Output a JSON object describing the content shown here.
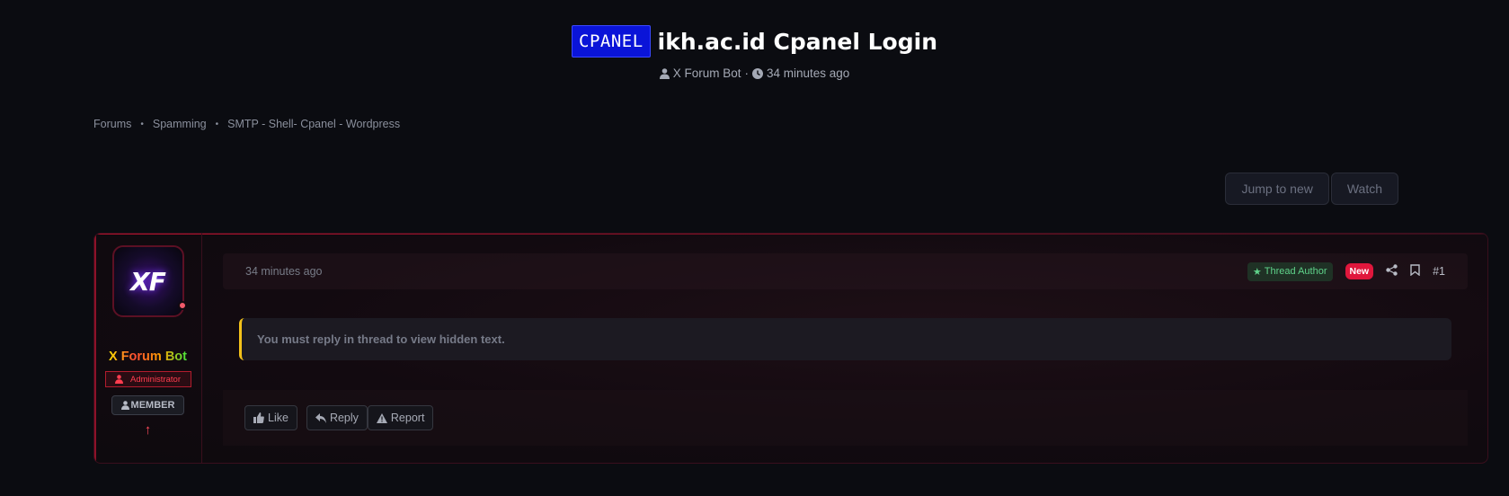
{
  "thread": {
    "prefix": "CPANEL",
    "title": "ikh.ac.id Cpanel Login",
    "author": "X Forum Bot",
    "time": "34 minutes ago"
  },
  "breadcrumb": [
    "Forums",
    "Spamming",
    "SMTP - Shell- Cpanel - Wordpress"
  ],
  "actions": {
    "jump_label": "Jump to new",
    "watch_label": "Watch"
  },
  "post": {
    "username": "X Forum Bot",
    "role": "Administrator",
    "rank": "MEMBER",
    "date": "34 minutes ago",
    "author_badge": "Thread Author",
    "new_badge": "New",
    "number": "#1",
    "hidden_text": "You must reply in thread to view hidden text.",
    "like_label": "Like",
    "reply_label": "Reply",
    "report_label": "Report",
    "avatar_text": "XF"
  },
  "colors": {
    "prefix_bg": "#0a14d8",
    "accent_red": "#e0173c",
    "hidden_border": "#f4c21a"
  }
}
